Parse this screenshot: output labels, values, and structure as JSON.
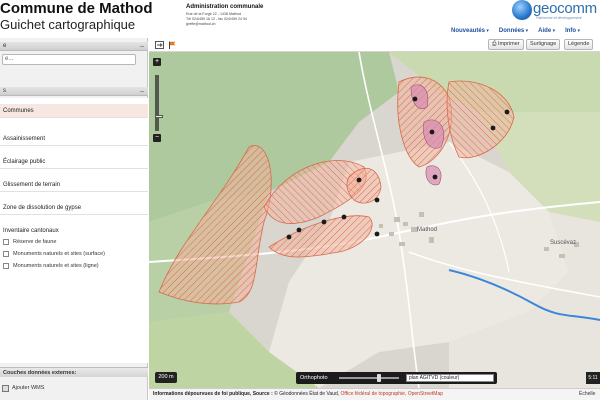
{
  "header": {
    "title": "Commune de Mathod",
    "subtitle": "Guichet cartographique",
    "admin_title": "Administration communale",
    "admin_lines": [
      "Rue de la Forge 22 - 1438 Mathod",
      "Tél 024/459 16 12 - fax 024/459 24 94",
      "greffe@mathod.ch"
    ],
    "logo_word": "geocomm",
    "logo_tagline": "Patrimoine et développement"
  },
  "top_nav": [
    "Nouveautés",
    "Données",
    "Aide",
    "Info"
  ],
  "toolbar": {
    "print_label": "Imprimer",
    "highlight_label": "Surlignage",
    "legend_label": "Légende"
  },
  "sidebar": {
    "search_title": "e",
    "search_placeholder": "e...",
    "layers_title": "s",
    "layers": [
      "Communes",
      "Assainissement",
      "Éclairage public",
      "Glissement de terrain",
      "Zone de dissolution de gypse"
    ],
    "inventory_title": "Inventaire cantonaux",
    "inventory_items": [
      "Réserve de faune",
      "Monuments naturels et sites (surface)",
      "Monuments naturels et sites (ligne)"
    ],
    "external_title": "Couches données externes:",
    "wms_label": "Ajouter WMS"
  },
  "map": {
    "place_mathod": "Mathod",
    "place_suscevaz": "Suscévaz",
    "scale_button": "200 m",
    "background_label": "Orthophoto",
    "background_select": "plan AGITVD (couleur)",
    "right_control": "5:11",
    "zoom_in": "+",
    "zoom_out": "−"
  },
  "footer": {
    "lead": "Informations dépourvues de foi publique, Source : ",
    "source_main": "© Géodonnées État de Vaud,",
    "source_office": "Office fédéral de topographie,",
    "source_osm": "OpenStreetMap",
    "scale_label": "Échelle"
  },
  "icons": {
    "tool_expand": "expand-icon",
    "tool_flag": "flag-icon",
    "print": "print-icon",
    "wms": "wms-icon"
  },
  "colors": {
    "hazard_fill": "#f0a78c",
    "hazard_stroke": "#d9694c",
    "gypsum_fill": "#d88ab0",
    "point_marker": "#1a1a1a",
    "river": "#3a86d8",
    "agri_green": "#c5d7a4",
    "village_grey": "#e8e6e1"
  }
}
